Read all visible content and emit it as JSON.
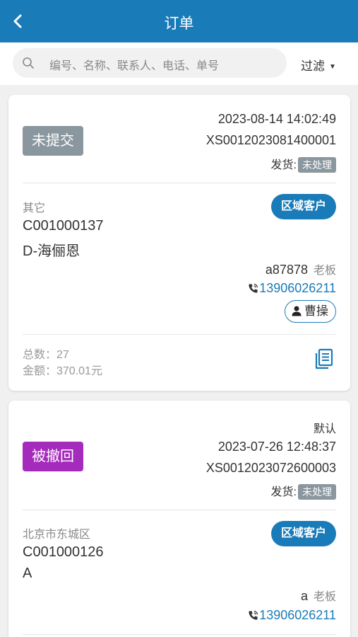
{
  "header": {
    "title": "订单",
    "back_icon": "chevron-left-icon"
  },
  "search": {
    "placeholder": "编号、名称、联系人、电话、单号",
    "filter_label": "过滤"
  },
  "colors": {
    "primary": "#1a7bb9",
    "status_grey": "#8a979f",
    "status_purple": "#a52bbd"
  },
  "orders": [
    {
      "status": "未提交",
      "extra": "",
      "datetime": "2023-08-14 14:02:49",
      "order_no": "XS0012023081400001",
      "ship_label": "发货:",
      "ship_status": "未处理",
      "region": "其它",
      "customer_code": "C001000137",
      "customer_name": "D-海俪恩",
      "customer_tag": "区域客户",
      "contact_name": "a87878",
      "contact_role": "老板",
      "phone": "13906026211",
      "salesperson": "曹操",
      "total_count": "总数：27",
      "total_amount": "金额：370.01元"
    },
    {
      "status": "被撤回",
      "extra": "默认",
      "datetime": "2023-07-26 12:48:37",
      "order_no": "XS0012023072600003",
      "ship_label": "发货:",
      "ship_status": "未处理",
      "region": "北京市东城区",
      "customer_code": "C001000126",
      "customer_name": "A",
      "customer_tag": "区域客户",
      "contact_name": "a",
      "contact_role": "老板",
      "phone": "13906026211"
    }
  ]
}
